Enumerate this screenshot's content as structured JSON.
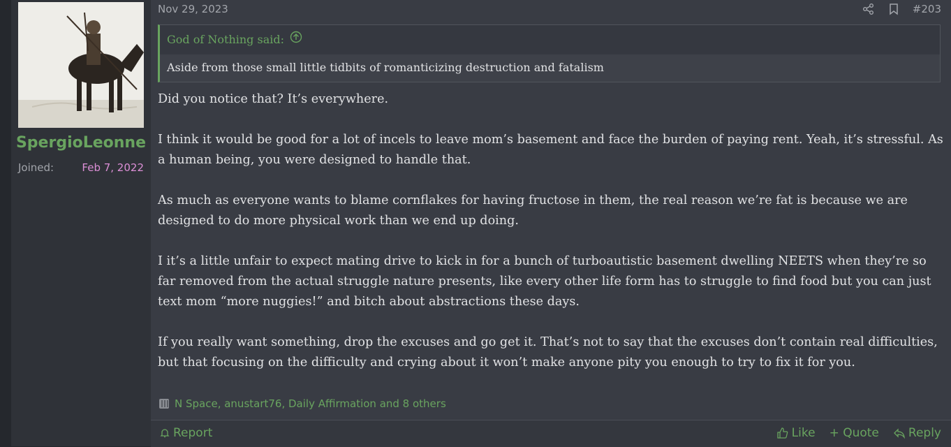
{
  "post": {
    "date": "Nov 29, 2023",
    "number": "#203",
    "user": {
      "name": "SpergioLeonne",
      "joined_label": "Joined:",
      "joined_date": "Feb 7, 2022",
      "name_color": "#69a45f"
    },
    "quote": {
      "author": "God of Nothing said:",
      "text": "Aside from those small little tidbits of romanticizing destruction and fatalism"
    },
    "body": [
      "Did you notice that? It’s everywhere.",
      "I think it would be good for a lot of incels to leave mom’s basement and face the burden of paying rent. Yeah, it’s stressful. As a human being, you were designed to handle that.",
      "As much as everyone wants to blame cornflakes for having fructose in them, the real reason we’re fat is because we are designed to do more physical work than we end up doing.",
      "I it’s a little unfair to expect mating drive to kick in for a bunch of turboautistic basement dwelling NEETS when they’re so far removed from the actual struggle nature presents, like every other life form has to struggle to find food but you can just text mom “more nuggies!” and bitch about abstractions these days.",
      "If you really want something, drop the excuses and go get it. That’s not to say that the excuses don’t contain real difficulties, but that focusing on the difficulty and crying about it won’t make anyone pity you enough to try to fix it for you."
    ],
    "reactions": "N Space, anustart76, Daily Affirmation and 8 others",
    "footer": {
      "report": "Report",
      "like": "Like",
      "quote": "+ Quote",
      "reply": "Reply"
    },
    "icons": [
      "share-icon",
      "bookmark-icon",
      "arrow-up-circle-icon",
      "bell-icon",
      "thumbs-up-icon",
      "reply-arrow-icon"
    ],
    "accent_color": "#69a45f"
  }
}
